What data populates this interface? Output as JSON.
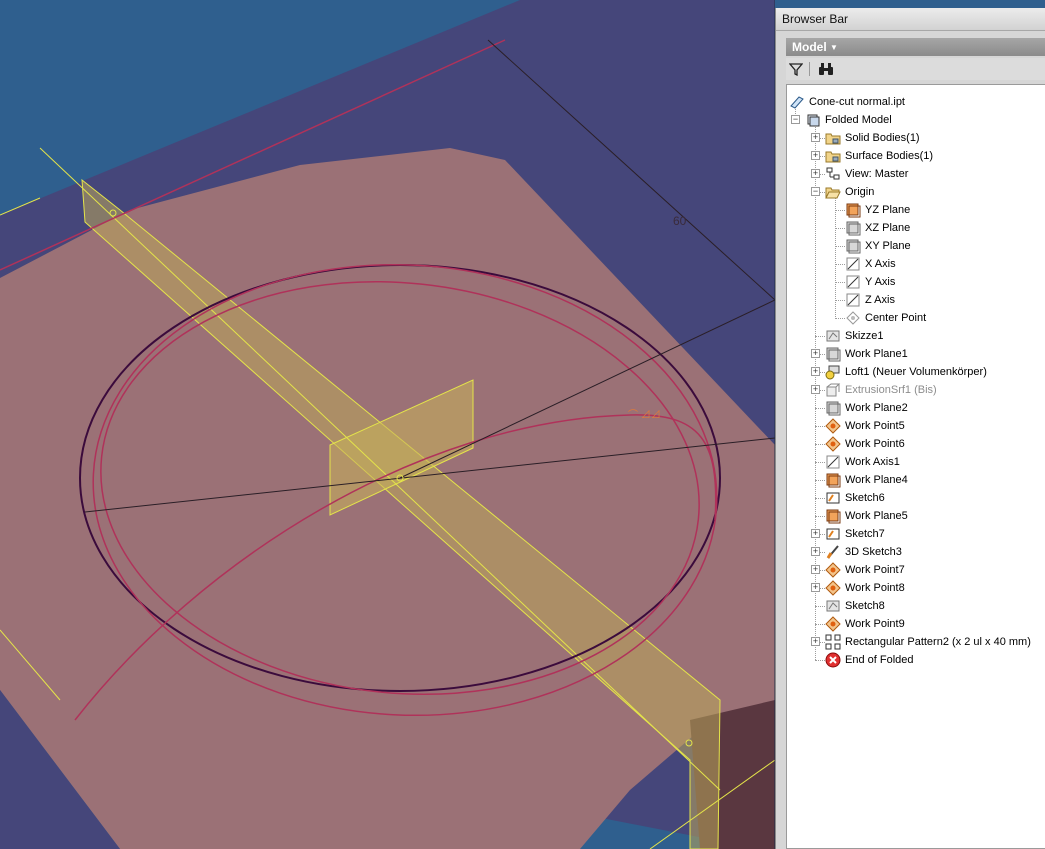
{
  "viewport": {
    "dimension_label": "60",
    "colors": {
      "background": "#2f5f8e",
      "plate": "#45467a",
      "surface": "#9b7176",
      "sketch_curve": "#b0325a",
      "sketch_circle": "#3b0b3c",
      "workplane": "#e4e44a"
    }
  },
  "browser": {
    "title": "Browser Bar",
    "model_label": "Model",
    "toolbar": {
      "filter_icon": "filter-icon",
      "find_icon": "binoculars-icon"
    },
    "tree": [
      {
        "label": "Cone-cut normal.ipt",
        "icon": "part-icon",
        "indent": 0,
        "expander": "none",
        "dim": false
      },
      {
        "label": "Folded Model",
        "icon": "model-icon",
        "indent": 1,
        "expander": "minus",
        "dim": false
      },
      {
        "label": "Solid Bodies(1)",
        "icon": "folder-icon",
        "indent": 2,
        "expander": "plus",
        "dim": false
      },
      {
        "label": "Surface Bodies(1)",
        "icon": "folder-icon",
        "indent": 2,
        "expander": "plus",
        "dim": false
      },
      {
        "label": "View: Master",
        "icon": "view-icon",
        "indent": 2,
        "expander": "plus",
        "dim": false
      },
      {
        "label": "Origin",
        "icon": "open-folder-icon",
        "indent": 2,
        "expander": "minus",
        "dim": false
      },
      {
        "label": "YZ Plane",
        "icon": "plane-orange-icon",
        "indent": 3,
        "expander": "none",
        "dim": false
      },
      {
        "label": "XZ Plane",
        "icon": "plane-gray-icon",
        "indent": 3,
        "expander": "none",
        "dim": false
      },
      {
        "label": "XY Plane",
        "icon": "plane-gray-icon",
        "indent": 3,
        "expander": "none",
        "dim": false
      },
      {
        "label": "X Axis",
        "icon": "axis-icon",
        "indent": 3,
        "expander": "none",
        "dim": false
      },
      {
        "label": "Y Axis",
        "icon": "axis-icon",
        "indent": 3,
        "expander": "none",
        "dim": false
      },
      {
        "label": "Z Axis",
        "icon": "axis-icon",
        "indent": 3,
        "expander": "none",
        "dim": false
      },
      {
        "label": "Center Point",
        "icon": "point-gray-icon",
        "indent": 3,
        "expander": "none",
        "dim": false
      },
      {
        "label": "Skizze1",
        "icon": "sketch-gray-icon",
        "indent": 2,
        "expander": "none",
        "dim": false
      },
      {
        "label": "Work Plane1",
        "icon": "plane-gray-icon",
        "indent": 2,
        "expander": "plus",
        "dim": false
      },
      {
        "label": "Loft1 (Neuer Volumenkörper)",
        "icon": "loft-icon",
        "indent": 2,
        "expander": "plus",
        "dim": false
      },
      {
        "label": "ExtrusionSrf1 (Bis)",
        "icon": "extrusion-surface-icon",
        "indent": 2,
        "expander": "plus",
        "dim": true
      },
      {
        "label": "Work Plane2",
        "icon": "plane-gray-icon",
        "indent": 2,
        "expander": "none",
        "dim": false
      },
      {
        "label": "Work Point5",
        "icon": "work-point-icon",
        "indent": 2,
        "expander": "none",
        "dim": false
      },
      {
        "label": "Work Point6",
        "icon": "work-point-icon",
        "indent": 2,
        "expander": "none",
        "dim": false
      },
      {
        "label": "Work Axis1",
        "icon": "axis-icon",
        "indent": 2,
        "expander": "none",
        "dim": false
      },
      {
        "label": "Work Plane4",
        "icon": "plane-orange-icon",
        "indent": 2,
        "expander": "none",
        "dim": false
      },
      {
        "label": "Sketch6",
        "icon": "sketch-icon",
        "indent": 2,
        "expander": "none",
        "dim": false
      },
      {
        "label": "Work Plane5",
        "icon": "plane-orange-icon",
        "indent": 2,
        "expander": "none",
        "dim": false
      },
      {
        "label": "Sketch7",
        "icon": "sketch-icon",
        "indent": 2,
        "expander": "plus",
        "dim": false
      },
      {
        "label": "3D Sketch3",
        "icon": "sketch3d-icon",
        "indent": 2,
        "expander": "plus",
        "dim": false
      },
      {
        "label": "Work Point7",
        "icon": "work-point-icon",
        "indent": 2,
        "expander": "plus",
        "dim": false
      },
      {
        "label": "Work Point8",
        "icon": "work-point-icon",
        "indent": 2,
        "expander": "plus",
        "dim": false
      },
      {
        "label": "Sketch8",
        "icon": "sketch-gray-icon",
        "indent": 2,
        "expander": "none",
        "dim": false
      },
      {
        "label": "Work Point9",
        "icon": "work-point-icon",
        "indent": 2,
        "expander": "none",
        "dim": false
      },
      {
        "label": "Rectangular Pattern2 (x 2 ul x 40 mm)",
        "icon": "pattern-icon",
        "indent": 2,
        "expander": "plus",
        "dim": false
      },
      {
        "label": "End of Folded",
        "icon": "end-of-part-icon",
        "indent": 2,
        "expander": "none",
        "dim": false
      }
    ]
  }
}
